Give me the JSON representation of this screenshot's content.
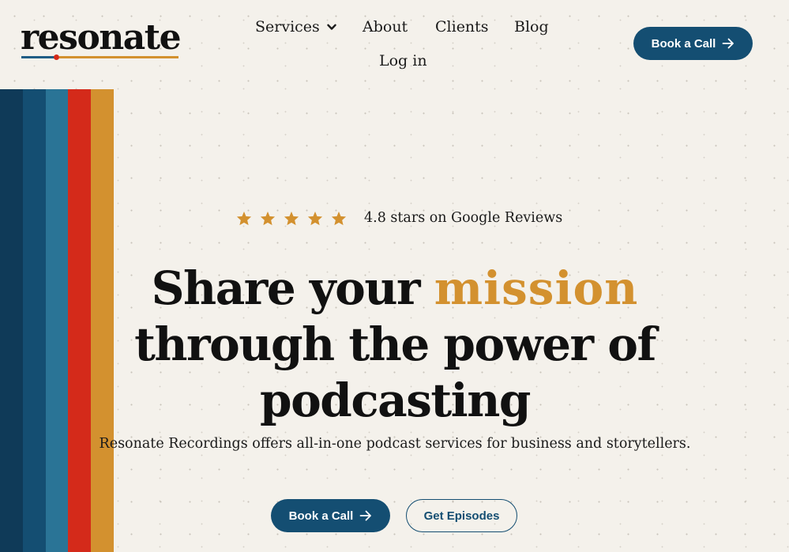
{
  "brand": {
    "logo_text": "resonate",
    "colors": {
      "navy": "#144e72",
      "deep_navy": "#0f3a58",
      "blue": "#1f5d85",
      "teal": "#2a7496",
      "red": "#d42a1a",
      "gold": "#d3912f",
      "background": "#f4f1eb"
    }
  },
  "nav": {
    "services": "Services",
    "about": "About",
    "clients": "Clients",
    "blog": "Blog",
    "login": "Log in"
  },
  "header": {
    "cta_label": "Book a Call",
    "cta_icon": "arrow-right-icon"
  },
  "stripes": [
    "#0f3a58",
    "#144e72",
    "#2a7496",
    "#d42a1a",
    "#d3912f"
  ],
  "hero": {
    "rating": {
      "stars": 5,
      "star_icon": "star-icon",
      "text": "4.8 stars on Google Reviews"
    },
    "headline_line1_a": "Share your ",
    "headline_line1_accent": "mission",
    "headline_line2": "through the power of",
    "headline_line3": "podcasting",
    "subtext": "Resonate Recordings offers all-in-one podcast services for business and storytellers.",
    "primary_cta": "Book a Call",
    "secondary_cta": "Get Episodes"
  }
}
